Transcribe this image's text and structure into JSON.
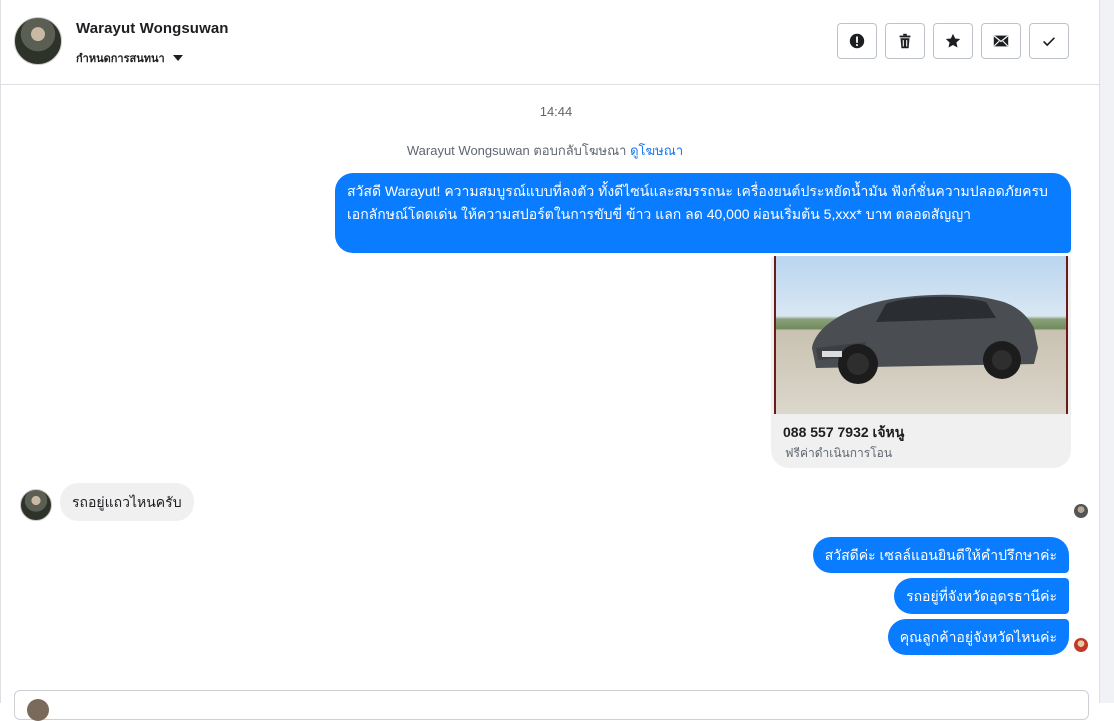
{
  "header": {
    "contact_name": "Warayut Wongsuwan",
    "label_menu": "กำหนดการสนทนา",
    "actions": [
      {
        "name": "report-button",
        "icon": "exclamation-icon"
      },
      {
        "name": "delete-button",
        "icon": "trash-icon"
      },
      {
        "name": "star-button",
        "icon": "star-icon"
      },
      {
        "name": "mark-unread-button",
        "icon": "envelope-icon"
      },
      {
        "name": "done-button",
        "icon": "check-icon"
      }
    ]
  },
  "conversation": {
    "timestamp": "14:44",
    "ad_reply_text": "Warayut Wongsuwan ตอบกลับโฆษณา",
    "ad_reply_link": "ดูโฆษณา",
    "messages": [
      {
        "from": "page",
        "text": "สวัสดี Warayut! ความสมบูรณ์แบบที่ลงตัว ทั้งดีไซน์และสมรรถนะ เครื่องยนต์ประหยัดน้ำมัน ฟังก์ชั่นความปลอดภัยครบ เอกลักษณ์โดดเด่น ให้ความสปอร์ตในการขับขี่ ข้าว แลก ลด 40,000 ผ่อนเริ่มต้น 5,xxx* บาท ตลอดสัญญา"
      },
      {
        "from": "customer",
        "text": "รถอยู่แถวไหนครับ"
      },
      {
        "from": "page",
        "text": "สวัสดีค่ะ เซลล์แอนยินดีให้คำปรึกษาค่ะ"
      },
      {
        "from": "page",
        "text": "รถอยู่ที่จังหวัดอุดรธานีค่ะ"
      },
      {
        "from": "page",
        "text": "คุณลูกค้าอยู่จังหวัดไหนค่ะ"
      }
    ],
    "ad_card": {
      "title": "088 557 7932 เจ้หนู",
      "subtitle": "ฟรีค่าดำเนินการโอน"
    }
  },
  "colors": {
    "outgoing_bubble": "#0a7cff",
    "incoming_bubble": "#f0f0f0",
    "link": "#1877f2"
  }
}
